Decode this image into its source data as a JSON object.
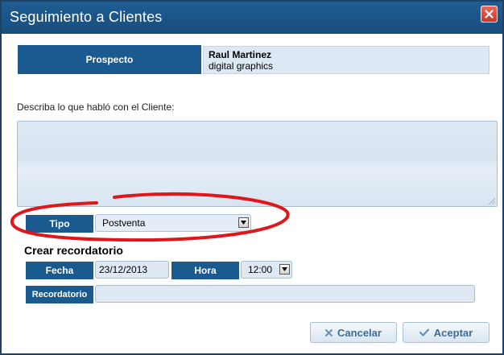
{
  "window": {
    "title": "Seguimiento a Clientes"
  },
  "prospect": {
    "label": "Prospecto",
    "name": "Raul Martinez",
    "company": "digital graphics"
  },
  "notes": {
    "prompt": "Describa lo que habló con el Cliente:",
    "value": ""
  },
  "tipo": {
    "label": "Tipo",
    "value": "Postventa"
  },
  "reminder": {
    "section_title": "Crear recordatorio",
    "fecha_label": "Fecha",
    "fecha_value": "23/12/2013",
    "hora_label": "Hora",
    "hora_value": "12:00",
    "recordatorio_label": "Recordatorio",
    "recordatorio_value": ""
  },
  "buttons": {
    "cancel": "Cancelar",
    "accept": "Aceptar"
  },
  "colors": {
    "titlebar": "#1f5d93",
    "label_bg": "#1b5a8e",
    "field_bg": "#dfe9f4",
    "annotation": "#e0161b",
    "button_text": "#3f6d98"
  },
  "icons": {
    "close": "close-icon",
    "cancel": "x-icon",
    "accept": "check-icon",
    "dropdown": "chevron-down-icon"
  }
}
